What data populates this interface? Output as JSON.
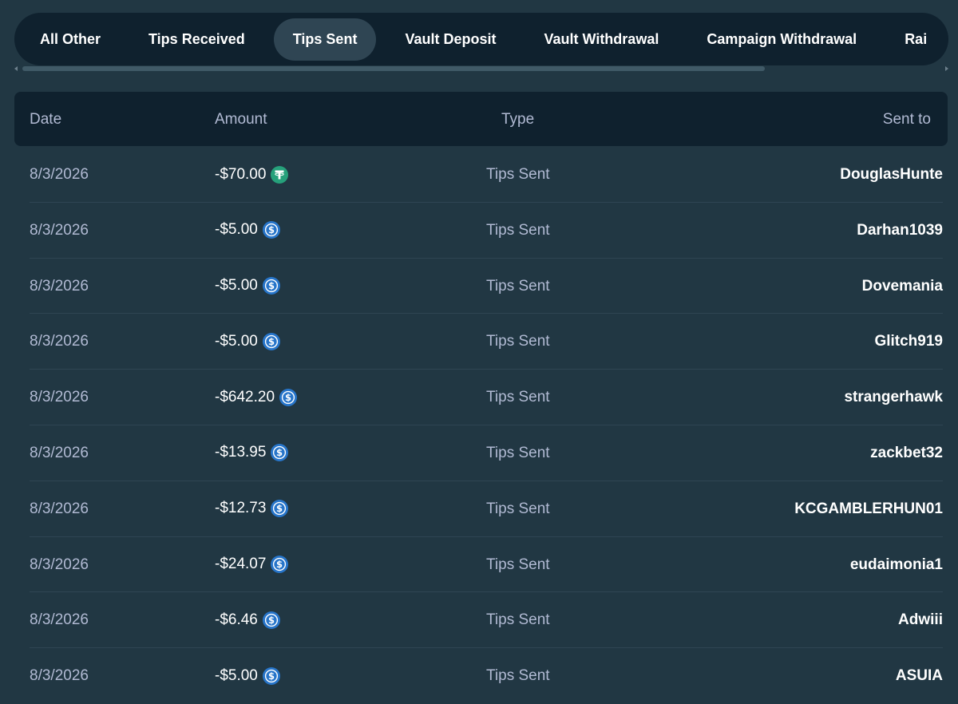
{
  "tabs": [
    {
      "label": "All Other",
      "active": false
    },
    {
      "label": "Tips Received",
      "active": false
    },
    {
      "label": "Tips Sent",
      "active": true
    },
    {
      "label": "Vault Deposit",
      "active": false
    },
    {
      "label": "Vault Withdrawal",
      "active": false
    },
    {
      "label": "Campaign Withdrawal",
      "active": false
    },
    {
      "label": "Rai",
      "active": false
    }
  ],
  "table": {
    "headers": {
      "date": "Date",
      "amount": "Amount",
      "type": "Type",
      "sent_to": "Sent to"
    },
    "rows": [
      {
        "date": "8/3/2026",
        "amount": "-$70.00",
        "currency_icon": "tether-icon",
        "type": "Tips Sent",
        "sent_to": "DouglasHunte"
      },
      {
        "date": "8/3/2026",
        "amount": "-$5.00",
        "currency_icon": "usdc-icon",
        "type": "Tips Sent",
        "sent_to": "Darhan1039"
      },
      {
        "date": "8/3/2026",
        "amount": "-$5.00",
        "currency_icon": "usdc-icon",
        "type": "Tips Sent",
        "sent_to": "Dovemania"
      },
      {
        "date": "8/3/2026",
        "amount": "-$5.00",
        "currency_icon": "usdc-icon",
        "type": "Tips Sent",
        "sent_to": "Glitch919"
      },
      {
        "date": "8/3/2026",
        "amount": "-$642.20",
        "currency_icon": "usdc-icon",
        "type": "Tips Sent",
        "sent_to": "strangerhawk"
      },
      {
        "date": "8/3/2026",
        "amount": "-$13.95",
        "currency_icon": "usdc-icon",
        "type": "Tips Sent",
        "sent_to": "zackbet32"
      },
      {
        "date": "8/3/2026",
        "amount": "-$12.73",
        "currency_icon": "usdc-icon",
        "type": "Tips Sent",
        "sent_to": "KCGAMBLERHUN01"
      },
      {
        "date": "8/3/2026",
        "amount": "-$24.07",
        "currency_icon": "usdc-icon",
        "type": "Tips Sent",
        "sent_to": "eudaimonia1"
      },
      {
        "date": "8/3/2026",
        "amount": "-$6.46",
        "currency_icon": "usdc-icon",
        "type": "Tips Sent",
        "sent_to": "Adwiii"
      },
      {
        "date": "8/3/2026",
        "amount": "-$5.00",
        "currency_icon": "usdc-icon",
        "type": "Tips Sent",
        "sent_to": "ASUIA"
      }
    ]
  },
  "colors": {
    "background": "#213743",
    "panel": "#0f212e",
    "active_tab": "#2f4553",
    "muted_text": "#b1bad3",
    "tether": "#26a17b",
    "usdc": "#2775ca"
  }
}
